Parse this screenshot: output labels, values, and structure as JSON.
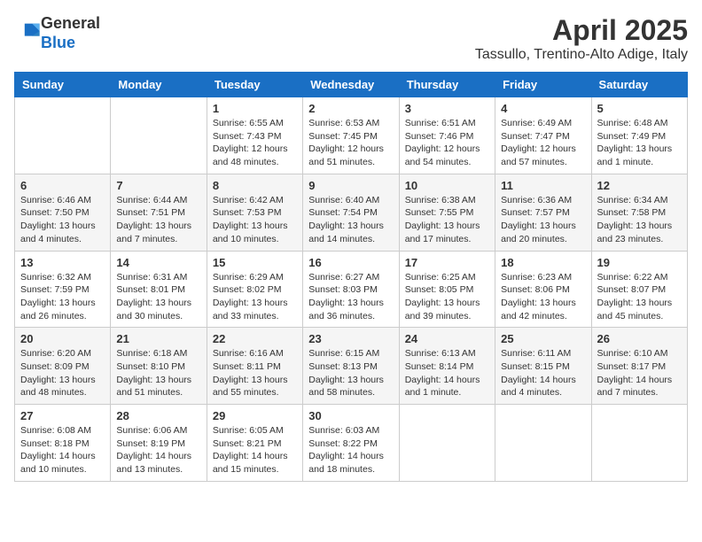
{
  "header": {
    "logo_line1": "General",
    "logo_line2": "Blue",
    "month_title": "April 2025",
    "location": "Tassullo, Trentino-Alto Adige, Italy"
  },
  "weekdays": [
    "Sunday",
    "Monday",
    "Tuesday",
    "Wednesday",
    "Thursday",
    "Friday",
    "Saturday"
  ],
  "weeks": [
    [
      {
        "day": "",
        "info": ""
      },
      {
        "day": "",
        "info": ""
      },
      {
        "day": "1",
        "info": "Sunrise: 6:55 AM\nSunset: 7:43 PM\nDaylight: 12 hours and 48 minutes."
      },
      {
        "day": "2",
        "info": "Sunrise: 6:53 AM\nSunset: 7:45 PM\nDaylight: 12 hours and 51 minutes."
      },
      {
        "day": "3",
        "info": "Sunrise: 6:51 AM\nSunset: 7:46 PM\nDaylight: 12 hours and 54 minutes."
      },
      {
        "day": "4",
        "info": "Sunrise: 6:49 AM\nSunset: 7:47 PM\nDaylight: 12 hours and 57 minutes."
      },
      {
        "day": "5",
        "info": "Sunrise: 6:48 AM\nSunset: 7:49 PM\nDaylight: 13 hours and 1 minute."
      }
    ],
    [
      {
        "day": "6",
        "info": "Sunrise: 6:46 AM\nSunset: 7:50 PM\nDaylight: 13 hours and 4 minutes."
      },
      {
        "day": "7",
        "info": "Sunrise: 6:44 AM\nSunset: 7:51 PM\nDaylight: 13 hours and 7 minutes."
      },
      {
        "day": "8",
        "info": "Sunrise: 6:42 AM\nSunset: 7:53 PM\nDaylight: 13 hours and 10 minutes."
      },
      {
        "day": "9",
        "info": "Sunrise: 6:40 AM\nSunset: 7:54 PM\nDaylight: 13 hours and 14 minutes."
      },
      {
        "day": "10",
        "info": "Sunrise: 6:38 AM\nSunset: 7:55 PM\nDaylight: 13 hours and 17 minutes."
      },
      {
        "day": "11",
        "info": "Sunrise: 6:36 AM\nSunset: 7:57 PM\nDaylight: 13 hours and 20 minutes."
      },
      {
        "day": "12",
        "info": "Sunrise: 6:34 AM\nSunset: 7:58 PM\nDaylight: 13 hours and 23 minutes."
      }
    ],
    [
      {
        "day": "13",
        "info": "Sunrise: 6:32 AM\nSunset: 7:59 PM\nDaylight: 13 hours and 26 minutes."
      },
      {
        "day": "14",
        "info": "Sunrise: 6:31 AM\nSunset: 8:01 PM\nDaylight: 13 hours and 30 minutes."
      },
      {
        "day": "15",
        "info": "Sunrise: 6:29 AM\nSunset: 8:02 PM\nDaylight: 13 hours and 33 minutes."
      },
      {
        "day": "16",
        "info": "Sunrise: 6:27 AM\nSunset: 8:03 PM\nDaylight: 13 hours and 36 minutes."
      },
      {
        "day": "17",
        "info": "Sunrise: 6:25 AM\nSunset: 8:05 PM\nDaylight: 13 hours and 39 minutes."
      },
      {
        "day": "18",
        "info": "Sunrise: 6:23 AM\nSunset: 8:06 PM\nDaylight: 13 hours and 42 minutes."
      },
      {
        "day": "19",
        "info": "Sunrise: 6:22 AM\nSunset: 8:07 PM\nDaylight: 13 hours and 45 minutes."
      }
    ],
    [
      {
        "day": "20",
        "info": "Sunrise: 6:20 AM\nSunset: 8:09 PM\nDaylight: 13 hours and 48 minutes."
      },
      {
        "day": "21",
        "info": "Sunrise: 6:18 AM\nSunset: 8:10 PM\nDaylight: 13 hours and 51 minutes."
      },
      {
        "day": "22",
        "info": "Sunrise: 6:16 AM\nSunset: 8:11 PM\nDaylight: 13 hours and 55 minutes."
      },
      {
        "day": "23",
        "info": "Sunrise: 6:15 AM\nSunset: 8:13 PM\nDaylight: 13 hours and 58 minutes."
      },
      {
        "day": "24",
        "info": "Sunrise: 6:13 AM\nSunset: 8:14 PM\nDaylight: 14 hours and 1 minute."
      },
      {
        "day": "25",
        "info": "Sunrise: 6:11 AM\nSunset: 8:15 PM\nDaylight: 14 hours and 4 minutes."
      },
      {
        "day": "26",
        "info": "Sunrise: 6:10 AM\nSunset: 8:17 PM\nDaylight: 14 hours and 7 minutes."
      }
    ],
    [
      {
        "day": "27",
        "info": "Sunrise: 6:08 AM\nSunset: 8:18 PM\nDaylight: 14 hours and 10 minutes."
      },
      {
        "day": "28",
        "info": "Sunrise: 6:06 AM\nSunset: 8:19 PM\nDaylight: 14 hours and 13 minutes."
      },
      {
        "day": "29",
        "info": "Sunrise: 6:05 AM\nSunset: 8:21 PM\nDaylight: 14 hours and 15 minutes."
      },
      {
        "day": "30",
        "info": "Sunrise: 6:03 AM\nSunset: 8:22 PM\nDaylight: 14 hours and 18 minutes."
      },
      {
        "day": "",
        "info": ""
      },
      {
        "day": "",
        "info": ""
      },
      {
        "day": "",
        "info": ""
      }
    ]
  ]
}
